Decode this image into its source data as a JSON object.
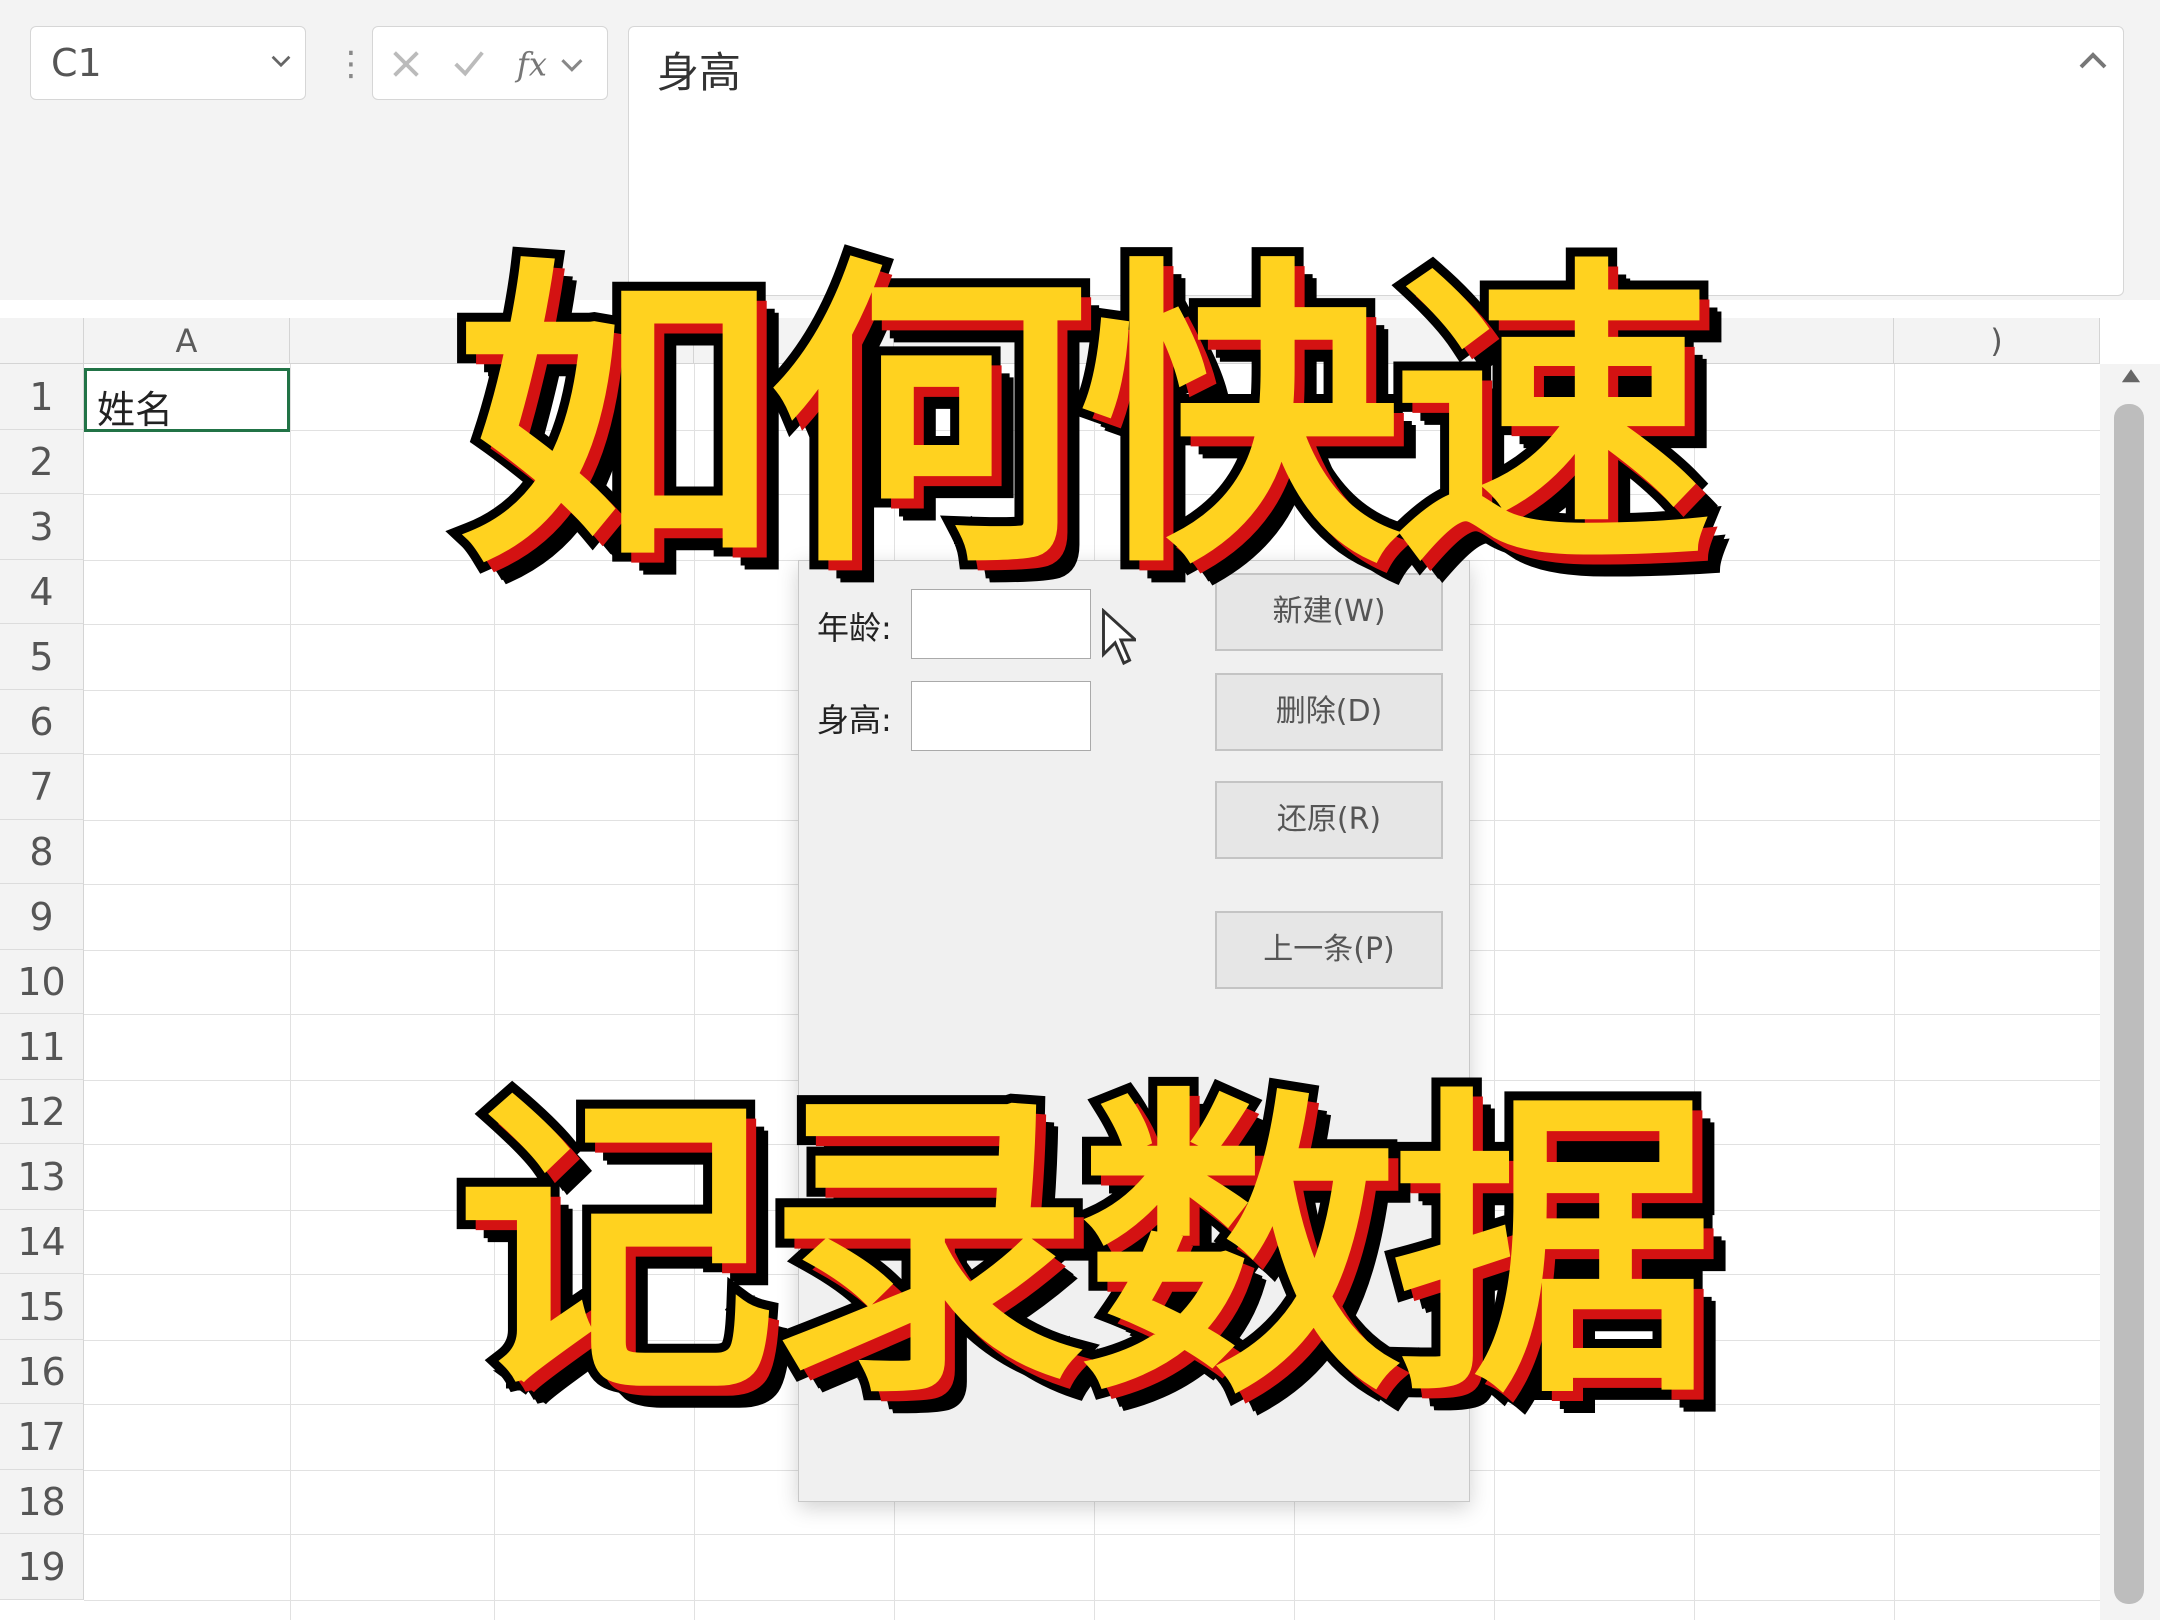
{
  "formula_bar": {
    "name_box": "C1",
    "formula_value": "身高"
  },
  "sheet": {
    "columns": [
      "A",
      "",
      "",
      "",
      "",
      "",
      "",
      "",
      "",
      ")"
    ],
    "rows": [
      "1",
      "2",
      "3",
      "4",
      "5",
      "6",
      "7",
      "8",
      "9",
      "10",
      "11",
      "12",
      "13",
      "14",
      "15",
      "16",
      "17",
      "18",
      "19"
    ],
    "cell_a1": "姓名"
  },
  "dialog": {
    "label_age": "年龄:",
    "label_height": "身高:",
    "btn_new": "新建(W)",
    "btn_delete": "删除(D)",
    "btn_restore": "还原(R)",
    "btn_prev": "上一条(P)"
  },
  "overlay": {
    "line1": "如何快速",
    "line2": "记录数据"
  },
  "colors": {
    "title_fill": "#ffd21f",
    "title_shadow": "#d41212",
    "selection": "#217346"
  }
}
